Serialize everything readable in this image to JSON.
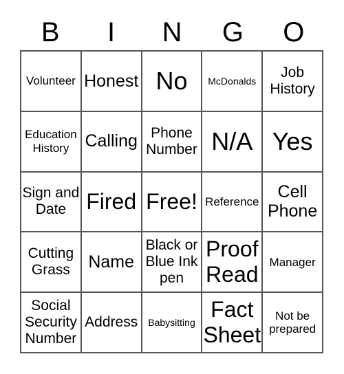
{
  "header": [
    "B",
    "I",
    "N",
    "G",
    "O"
  ],
  "cells": [
    {
      "text": "Volunteer",
      "size": "s-sm"
    },
    {
      "text": "Honest",
      "size": "s-lg"
    },
    {
      "text": "No",
      "size": "s-xxl"
    },
    {
      "text": "McDonalds",
      "size": "s-xs"
    },
    {
      "text": "Job History",
      "size": "s-md"
    },
    {
      "text": "Education History",
      "size": "s-sm"
    },
    {
      "text": "Calling",
      "size": "s-lg"
    },
    {
      "text": "Phone Number",
      "size": "s-md"
    },
    {
      "text": "N/A",
      "size": "s-xxl"
    },
    {
      "text": "Yes",
      "size": "s-xxl"
    },
    {
      "text": "Sign and Date",
      "size": "s-md"
    },
    {
      "text": "Fired",
      "size": "s-xl"
    },
    {
      "text": "Free!",
      "size": "s-xl"
    },
    {
      "text": "Reference",
      "size": "s-sm"
    },
    {
      "text": "Cell Phone",
      "size": "s-lg"
    },
    {
      "text": "Cutting Grass",
      "size": "s-md"
    },
    {
      "text": "Name",
      "size": "s-lg"
    },
    {
      "text": "Black or Blue Ink pen",
      "size": "s-md"
    },
    {
      "text": "Proof Read",
      "size": "s-xl"
    },
    {
      "text": "Manager",
      "size": "s-sm"
    },
    {
      "text": "Social Security Number",
      "size": "s-md"
    },
    {
      "text": "Address",
      "size": "s-md"
    },
    {
      "text": "Babysitting",
      "size": "s-xs"
    },
    {
      "text": "Fact Sheet",
      "size": "s-xl"
    },
    {
      "text": "Not be prepared",
      "size": "s-sm"
    }
  ]
}
